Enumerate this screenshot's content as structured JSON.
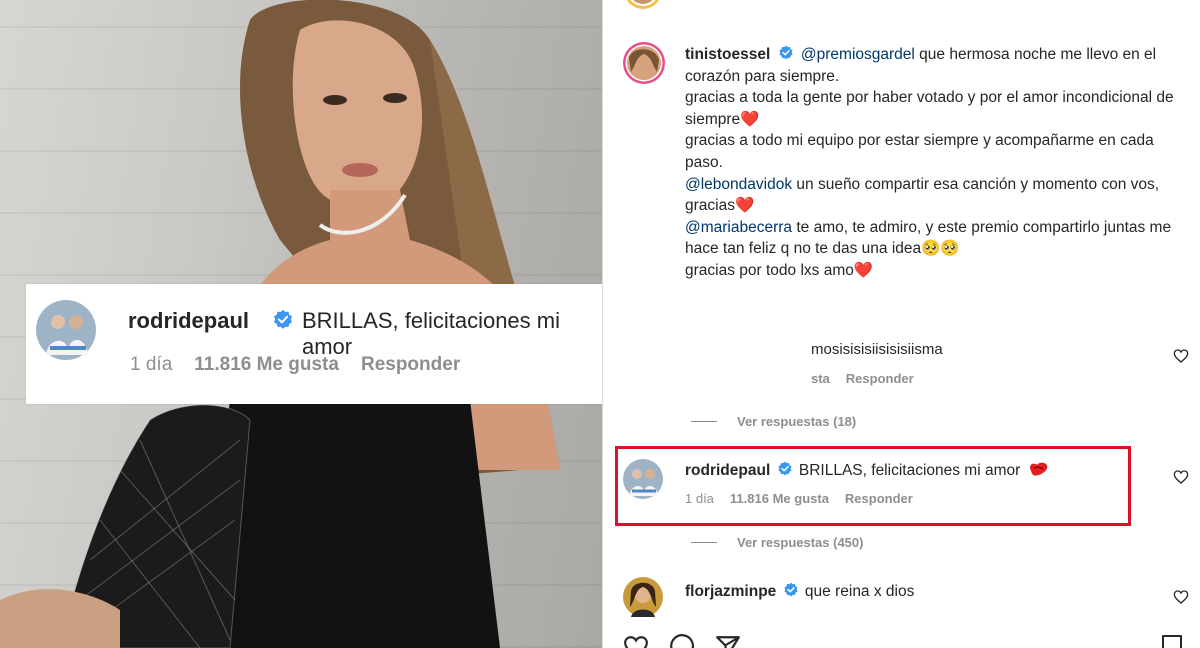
{
  "zoom_comment": {
    "username": "rodridepaul",
    "text": "BRILLAS, felicitaciones mi amor",
    "time": "1 día",
    "likes": "11.816 Me gusta",
    "reply": "Responder"
  },
  "post": {
    "username": "tinistoessel",
    "caption_lines": [
      {
        "mention": "@premiosgardel",
        "text": " que hermosa noche me llevo en el corazón para siempre."
      },
      {
        "mention": "",
        "text": "gracias a toda la gente por haber votado y por el amor incondicional de siempre❤️"
      },
      {
        "mention": "",
        "text": "gracias a todo mi equipo por estar siempre y acompañarme en cada paso."
      },
      {
        "mention": "@lebondavidok",
        "text": " un sueño compartir esa canción y momento con vos, gracias❤️"
      },
      {
        "mention": "@mariabecerra",
        "text": " te amo, te admiro, y este premio compartirlo juntas me hace tan feliz q no te das una idea🥺🥺"
      },
      {
        "mention": "",
        "text": "gracias por todo lxs amo❤️"
      }
    ]
  },
  "comments": {
    "first": {
      "text": "mosisisisiisisisiisma",
      "meta_fragment": "sta",
      "reply": "Responder",
      "view_replies": "Ver respuestas (18)"
    },
    "highlighted": {
      "username": "rodridepaul",
      "text": "BRILLAS, felicitaciones mi amor",
      "time": "1 día",
      "likes": "11.816 Me gusta",
      "reply": "Responder",
      "view_replies": "Ver respuestas (450)"
    },
    "third": {
      "username": "florjazminpe",
      "text": "que reina x dios"
    }
  },
  "colors": {
    "highlight_border": "#e0102a",
    "verified": "#3897f0",
    "heart": "#ed4956",
    "mention": "#00376b"
  },
  "icons": [
    "heart-icon",
    "comment-icon",
    "share-icon",
    "save-icon",
    "verified-icon"
  ]
}
